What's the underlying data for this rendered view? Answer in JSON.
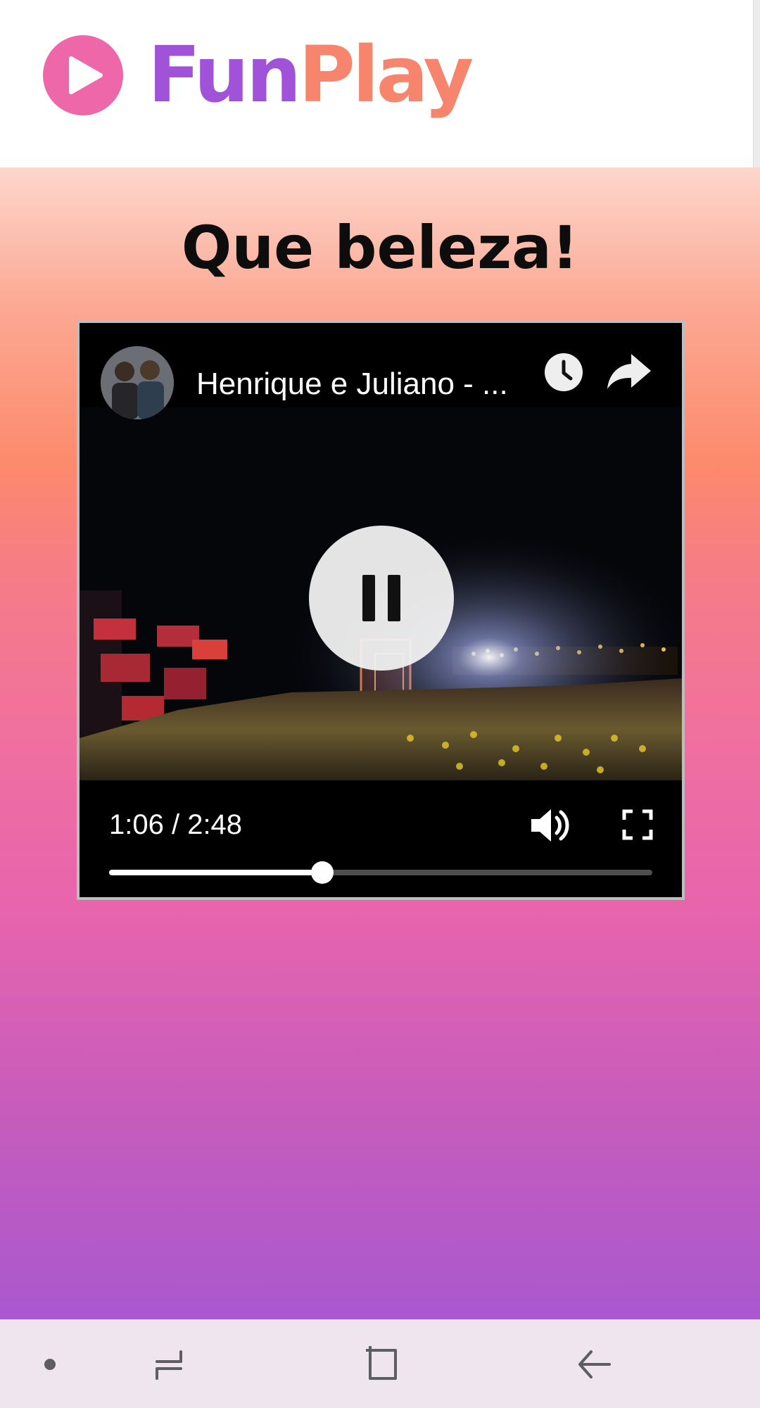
{
  "app": {
    "name_part1": "Fun",
    "name_part2": "Play",
    "brand_colors": {
      "logo_icon": "#ee68a9",
      "fun": "#a052d8",
      "play": "#f7856d"
    }
  },
  "page": {
    "title": "Que beleza!"
  },
  "player": {
    "video_title": "Henrique e Juliano - ...",
    "elapsed_time": "1:06",
    "duration": "2:48",
    "time_display": "1:06 / 2:48",
    "progress_fraction": 0.393,
    "state": "playing",
    "icons": {
      "avatar": "channel-avatar-icon",
      "watch_later": "clock-icon",
      "share": "share-icon",
      "pause": "pause-icon",
      "volume": "volume-icon",
      "fullscreen": "fullscreen-icon"
    }
  },
  "navigation_bar": {
    "icons": [
      "dot-icon",
      "recents-icon",
      "home-icon",
      "back-icon"
    ]
  }
}
